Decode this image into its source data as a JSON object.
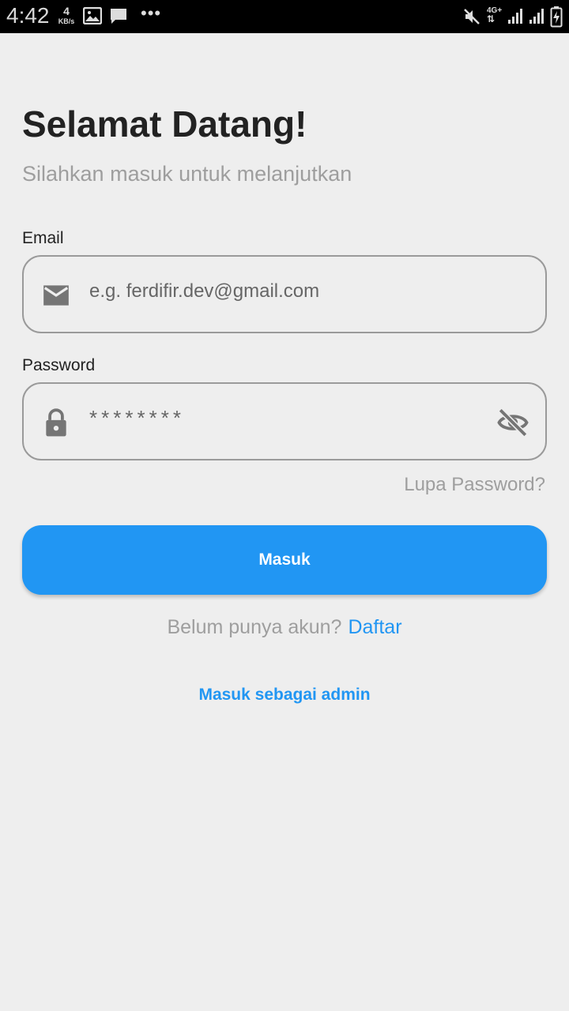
{
  "status_bar": {
    "time": "4:42",
    "speed_value": "4",
    "speed_unit": "KB/s",
    "more": "•••",
    "network": "4G+",
    "icons": [
      "image-icon",
      "chat-icon",
      "mute-icon",
      "signal-icon",
      "battery-charging-icon"
    ]
  },
  "header": {
    "title": "Selamat Datang!",
    "subtitle": "Silahkan masuk untuk melanjutkan"
  },
  "email": {
    "label": "Email",
    "placeholder": "e.g. ferdifir.dev@gmail.com",
    "icon": "mail-icon"
  },
  "password": {
    "label": "Password",
    "value": "********",
    "icon": "lock-icon",
    "toggle_icon": "eye-off-icon"
  },
  "forgot_password": "Lupa Password?",
  "login_button": "Masuk",
  "signup": {
    "question": "Belum punya akun?",
    "link": "Daftar"
  },
  "admin_link": "Masuk sebagai admin",
  "colors": {
    "primary": "#2196f3",
    "background": "#eeeeee",
    "title": "#222222",
    "muted": "#9e9e9e"
  }
}
